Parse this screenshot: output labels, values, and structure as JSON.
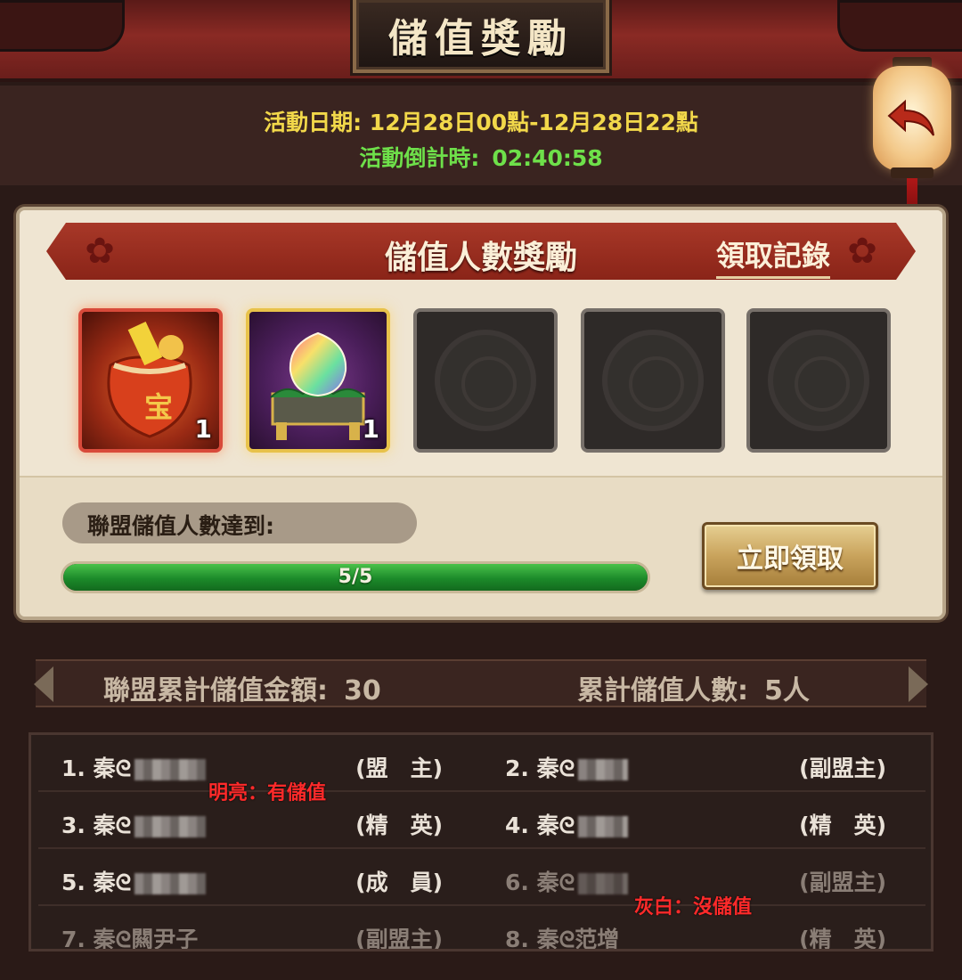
{
  "header": {
    "title": "儲值獎勵"
  },
  "event": {
    "date_label": "活動日期:",
    "date_value": "12月28日00點-12月28日22點",
    "countdown_label": "活動倒計時:",
    "countdown_value": "02:40:58"
  },
  "reward_panel": {
    "title": "儲值人數獎勵",
    "record_link": "領取記錄",
    "items": [
      {
        "icon": "treasure-bag-icon",
        "count": "1"
      },
      {
        "icon": "peach-chest-icon",
        "count": "1"
      },
      {
        "icon": "empty-slot-icon",
        "count": ""
      },
      {
        "icon": "empty-slot-icon",
        "count": ""
      },
      {
        "icon": "empty-slot-icon",
        "count": ""
      }
    ],
    "progress_label": "聯盟儲值人數達到:",
    "progress_text": "5/5",
    "progress_fraction": 1.0,
    "claim_button": "立即領取"
  },
  "totals": {
    "amount_label": "聯盟累計儲值金額:",
    "amount_value": "30",
    "count_label": "累計儲值人數:",
    "count_value": "5人"
  },
  "members": [
    {
      "index": "1.",
      "name": "秦ᘓ",
      "role": "(盟　主)",
      "bright": true
    },
    {
      "index": "2.",
      "name": "秦ᘓ",
      "role": "(副盟主)",
      "bright": true
    },
    {
      "index": "3.",
      "name": "秦ᘓ",
      "role": "(精　英)",
      "bright": true
    },
    {
      "index": "4.",
      "name": "秦ᘓ",
      "role": "(精　英)",
      "bright": true
    },
    {
      "index": "5.",
      "name": "秦ᘓ",
      "role": "(成　員)",
      "bright": true
    },
    {
      "index": "6.",
      "name": "秦ᘓ",
      "role": "(副盟主)",
      "bright": false
    },
    {
      "index": "7.",
      "name": "秦ᘓ闗尹子",
      "role": "(副盟主)",
      "bright": false
    },
    {
      "index": "8.",
      "name": "秦ᘓ范增",
      "role": "(精　英)",
      "bright": false
    }
  ],
  "annotations": {
    "bright": "明亮：有儲值",
    "dim": "灰白：沒儲值"
  },
  "colors": {
    "date": "#f2d84a",
    "countdown": "#6ee04a",
    "annotation": "#ff2a2a"
  }
}
